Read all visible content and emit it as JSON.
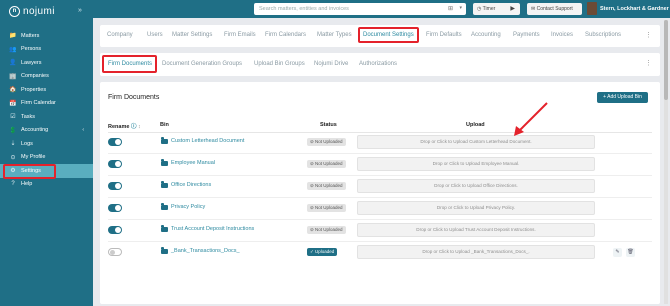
{
  "app": {
    "logo": "nojumi",
    "collapse": "»"
  },
  "sidebar": {
    "items": [
      {
        "label": "Matters",
        "icon": "📁"
      },
      {
        "label": "Persons",
        "icon": "👥"
      },
      {
        "label": "Lawyers",
        "icon": "👤"
      },
      {
        "label": "Companies",
        "icon": "🏢"
      },
      {
        "label": "Properties",
        "icon": "🏠"
      },
      {
        "label": "Firm Calendar",
        "icon": "📅"
      },
      {
        "label": "Tasks",
        "icon": "☑"
      },
      {
        "label": "Accounting",
        "icon": "💲",
        "chevron": "‹"
      },
      {
        "label": "Logs",
        "icon": "⇣"
      },
      {
        "label": "My Profile",
        "icon": "⊙"
      },
      {
        "label": "Settings",
        "icon": "⚙"
      },
      {
        "label": "Help",
        "icon": "?"
      }
    ]
  },
  "topbar": {
    "search_placeholder": "Search matters, entities and invoices",
    "timer_label": "Timer",
    "support_label": "Contact Support",
    "firm_name": "Stern, Lockhart & Gardner"
  },
  "tabs_main": [
    "Company",
    "Users",
    "Matter Settings",
    "Firm Emails",
    "Firm Calendars",
    "Matter Types",
    "Document Settings",
    "Firm Defaults",
    "Accounting",
    "Payments",
    "Invoices",
    "Subscriptions"
  ],
  "tabs_sub": [
    "Firm Documents",
    "Document Generation Groups",
    "Upload Bin Groups",
    "Nojumi Drive",
    "Authorizations"
  ],
  "card": {
    "title": "Firm Documents",
    "add_button": "Add Upload Bin"
  },
  "table": {
    "headers": {
      "rename": "Rename",
      "bin": "Bin",
      "status": "Status",
      "upload": "Upload"
    },
    "rows": [
      {
        "bin": "Custom Letterhead Document",
        "status": "Not Uploaded",
        "drop": "Drop or Click to Upload Custom Letterhead Document.",
        "enabled": true
      },
      {
        "bin": "Employee Manual",
        "status": "Not Uploaded",
        "drop": "Drop or Click to Upload Employee Manual.",
        "enabled": true
      },
      {
        "bin": "Office Directions",
        "status": "Not Uploaded",
        "drop": "Drop or Click to Upload Office Directions.",
        "enabled": true
      },
      {
        "bin": "Privacy Policy",
        "status": "Not Uploaded",
        "drop": "Drop or Click to Upload Privacy Policy.",
        "enabled": true
      },
      {
        "bin": "Trust Account Deposit Instructions",
        "status": "Not Uploaded",
        "drop": "Drop or Click to Upload Trust Account Deposit Instructions.",
        "enabled": true
      },
      {
        "bin": "_Bank_Transactions_Docs_",
        "status": "Uploaded",
        "drop": "Drop or Click to Upload _Bank_Transactions_Docs_.",
        "enabled": false
      }
    ]
  },
  "colors": {
    "brand": "#1f6f86",
    "highlight": "#e4222b"
  }
}
